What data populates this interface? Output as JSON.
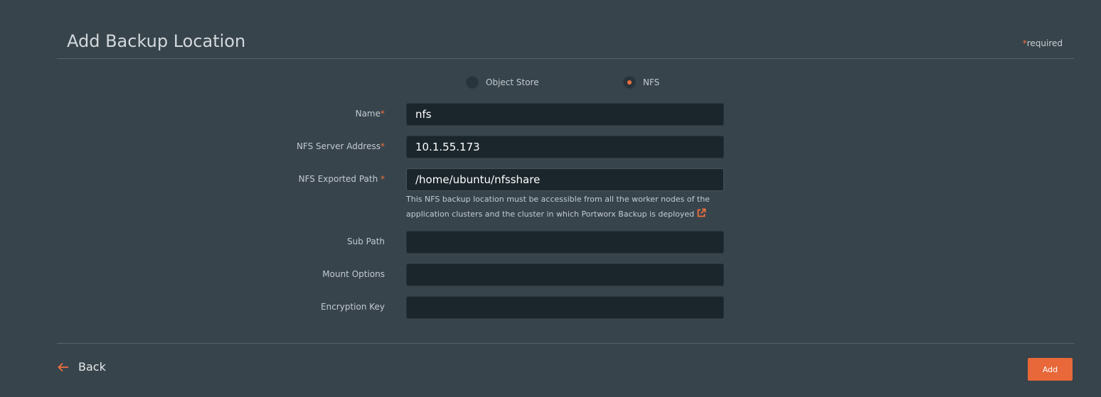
{
  "header": {
    "title": "Add Backup Location",
    "required_star": "*",
    "required_text": "required"
  },
  "location_type": {
    "options": [
      {
        "label": "Object Store",
        "selected": false
      },
      {
        "label": "NFS",
        "selected": true
      }
    ]
  },
  "form": {
    "name": {
      "label": "Name",
      "star": "*",
      "value": "nfs"
    },
    "server_address": {
      "label": "NFS Server Address",
      "star": "*",
      "value": "10.1.55.173"
    },
    "exported_path": {
      "label": "NFS Exported Path ",
      "star": "*",
      "value": "/home/ubuntu/nfsshare",
      "helper_line1": "This NFS backup location must be accessible from all the worker nodes of the",
      "helper_line2": "application clusters and the cluster in which Portworx Backup is deployed"
    },
    "sub_path": {
      "label": "Sub Path",
      "value": ""
    },
    "mount_options": {
      "label": "Mount Options",
      "value": ""
    },
    "encryption_key": {
      "label": "Encryption Key",
      "value": ""
    }
  },
  "footer": {
    "back_label": "Back",
    "add_label": "Add"
  },
  "colors": {
    "background": "#37444c",
    "input_bg": "#1b262c",
    "accent": "#ef6f3c",
    "button": "#e8683a"
  },
  "icons": {
    "external_link": "external-link-icon",
    "back": "arrow-left-icon"
  }
}
